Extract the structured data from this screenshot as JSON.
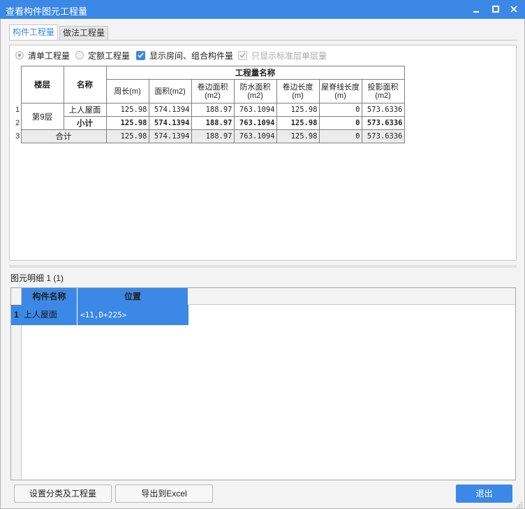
{
  "window": {
    "title": "查看构件图元工程量"
  },
  "tabs": [
    {
      "label": "构件工程量",
      "active": true
    },
    {
      "label": "做法工程量",
      "active": false
    }
  ],
  "options": {
    "radio1": "清单工程量",
    "radio2": "定额工程量",
    "check1": "显示房间、组合构件量",
    "check2": "只显示标准层单层量"
  },
  "table": {
    "col_floor": "楼层",
    "col_name": "名称",
    "group_header": "工程量名称",
    "columns": [
      "周长(m)",
      "面积(m2)",
      "卷边面积(m2)",
      "防水面积(m2)",
      "卷边长度(m)",
      "屋脊线长度(m)",
      "投影面积(m2)"
    ],
    "rows": [
      {
        "no": "1",
        "floor": "第9层",
        "name": "上人屋面",
        "values": [
          "125.98",
          "574.1394",
          "188.97",
          "763.1094",
          "125.98",
          "0",
          "573.6336"
        ]
      },
      {
        "no": "2",
        "floor": "",
        "name": "小计",
        "values": [
          "125.98",
          "574.1394",
          "188.97",
          "763.1094",
          "125.98",
          "0",
          "573.6336"
        ]
      },
      {
        "no": "3",
        "floor": "合计",
        "name": "",
        "values": [
          "125.98",
          "574.1394",
          "188.97",
          "763.1094",
          "125.98",
          "0",
          "573.6336"
        ]
      }
    ]
  },
  "detail": {
    "title": "图元明细  1 (1)",
    "col_name": "构件名称",
    "col_position": "位置",
    "rows": [
      {
        "no": "1",
        "name": "上人屋面",
        "position": "<11,D+225>"
      }
    ]
  },
  "buttons": {
    "settings": "设置分类及工程量",
    "export": "导出到Excel",
    "exit": "退出"
  },
  "colors": {
    "accent": "#3b88e6"
  }
}
